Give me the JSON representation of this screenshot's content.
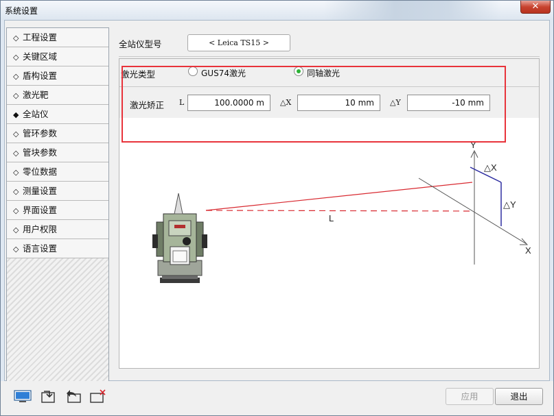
{
  "window": {
    "title": "系统设置",
    "close_glyph": "✕"
  },
  "sidebar": {
    "items": [
      {
        "label": "工程设置",
        "bullet": "◇"
      },
      {
        "label": "关键区域",
        "bullet": "◇"
      },
      {
        "label": "盾构设置",
        "bullet": "◇"
      },
      {
        "label": "激光靶",
        "bullet": "◇"
      },
      {
        "label": "全站仪",
        "bullet": "◆"
      },
      {
        "label": "管环参数",
        "bullet": "◇"
      },
      {
        "label": "管块参数",
        "bullet": "◇"
      },
      {
        "label": "零位数据",
        "bullet": "◇"
      },
      {
        "label": "测量设置",
        "bullet": "◇"
      },
      {
        "label": "界面设置",
        "bullet": "◇"
      },
      {
        "label": "用户权限",
        "bullet": "◇"
      },
      {
        "label": "语言设置",
        "bullet": "◇"
      }
    ],
    "selected": "全站仪"
  },
  "main": {
    "model_label": "全站仪型号",
    "model_value": "< Leica TS15 >",
    "laser_type_label": "激光类型",
    "laser_options": [
      {
        "label": "GUS74激光",
        "checked": false
      },
      {
        "label": "同轴激光",
        "checked": true
      }
    ],
    "correction_label": "激光矫正",
    "fields": {
      "L": {
        "label": "L",
        "value": "100.0000  m"
      },
      "dX": {
        "label": "△X",
        "value": "10  mm"
      },
      "dY": {
        "label": "△Y",
        "value": "-10  mm"
      }
    },
    "diagram": {
      "L": "L",
      "axis_y": "Y",
      "axis_x": "X",
      "dx": "△X",
      "dy": "△Y"
    }
  },
  "toolbar": {
    "icons": [
      "monitor-icon",
      "import-icon",
      "undo-icon",
      "clear-icon"
    ],
    "apply_label": "应用",
    "exit_label": "退出"
  },
  "colors": {
    "highlight_box": "#e8323a",
    "laser_line": "#d8282f",
    "radio_checked": "#2db236",
    "offset_line": "#2c2ca0"
  }
}
